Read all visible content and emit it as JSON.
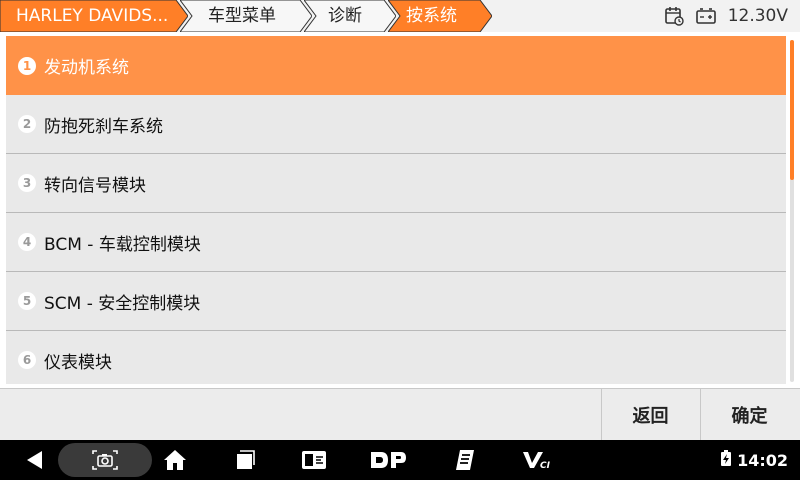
{
  "breadcrumb": {
    "items": [
      "HARLEY DAVIDS...",
      "车型菜单",
      "诊断",
      "按系统"
    ]
  },
  "status": {
    "voltage": "12.30V"
  },
  "list": {
    "items": [
      {
        "num": "1",
        "label": "发动机系统"
      },
      {
        "num": "2",
        "label": "防抱死刹车系统"
      },
      {
        "num": "3",
        "label": "转向信号模块"
      },
      {
        "num": "4",
        "label": "BCM - 车载控制模块"
      },
      {
        "num": "5",
        "label": "SCM - 安全控制模块"
      },
      {
        "num": "6",
        "label": "仪表模块"
      }
    ]
  },
  "actions": {
    "back": "返回",
    "ok": "确定"
  },
  "navbar": {
    "time": "14:02"
  },
  "colors": {
    "accent": "#ff9248",
    "crumb_active": "#ff7f27"
  }
}
